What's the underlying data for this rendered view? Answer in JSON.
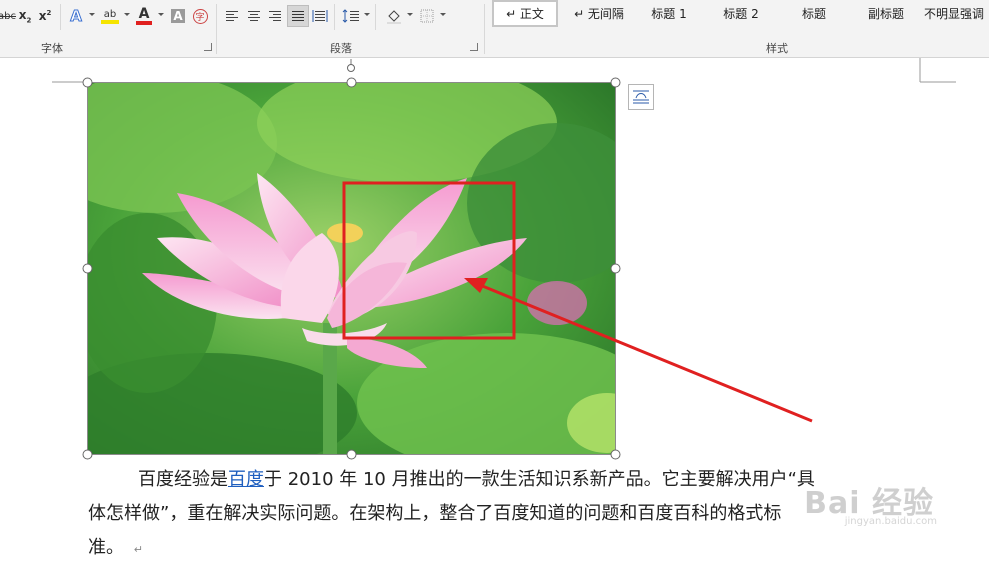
{
  "ribbon": {
    "font_group": {
      "label": "字体",
      "buttons": [
        {
          "name": "strikethrough-button",
          "glyph": "abc"
        },
        {
          "name": "subscript-button",
          "glyph": "x₂"
        },
        {
          "name": "superscript-button",
          "glyph": "x²"
        },
        {
          "name": "text-effects-button",
          "glyph": "A"
        },
        {
          "name": "highlight-button",
          "glyph": "ab"
        },
        {
          "name": "font-color-button",
          "glyph": "A"
        },
        {
          "name": "char-shading-button",
          "glyph": "A"
        },
        {
          "name": "enclose-char-button",
          "glyph": "字"
        }
      ]
    },
    "paragraph_group": {
      "label": "段落"
    },
    "styles_group": {
      "label": "样式",
      "items": [
        "↵ 正文",
        "↵ 无间隔",
        "标题 1",
        "标题 2",
        "标题",
        "副标题",
        "不明显强调"
      ]
    },
    "colors": {
      "highlight": "#f5e400",
      "font_color": "#e0201f",
      "accent": "#e53935"
    }
  },
  "document": {
    "paragraph": {
      "before_link": "百度经验是",
      "link": "百度",
      "after_link_line1": "于 2010 年 10 月推出的一款生活知识系新产品。它主要解决用户“具",
      "line2": "体怎样做”，重在解决实际问题。在架构上，整合了百度知道的问题和百度百科的格式标",
      "line3": "准。",
      "para_mark": "↵"
    },
    "image": {
      "subject": "pink lotus flower among green leaves"
    },
    "annotation": {
      "color": "#e02020"
    }
  },
  "watermark": {
    "text": "Bai 经验",
    "subtext": "jingyan.baidu.com"
  }
}
